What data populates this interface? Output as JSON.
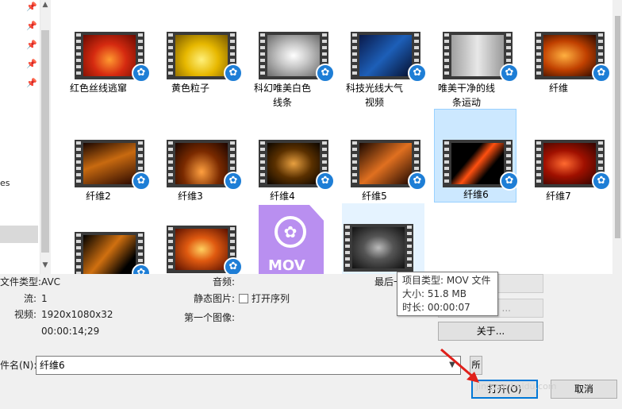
{
  "files": [
    {
      "name": "红色丝线逃窜"
    },
    {
      "name": "黄色粒子"
    },
    {
      "name": "科幻唯美白色线条"
    },
    {
      "name": "科技光线大气视频"
    },
    {
      "name": "唯美干净的线条运动"
    },
    {
      "name": "纤维"
    },
    {
      "name": "纤维2"
    },
    {
      "name": "纤维3"
    },
    {
      "name": "纤维4"
    },
    {
      "name": "纤维5"
    },
    {
      "name": "纤维6"
    },
    {
      "name": "纤维7"
    }
  ],
  "nav": {
    "partial_text": "es"
  },
  "mov_icon": {
    "label": "MOV"
  },
  "details": {
    "file_type_label": "文件类型:",
    "file_type_value": "AVC",
    "stream_label": "流:",
    "stream_value": "1",
    "video_label": "视频:",
    "video_value": "1920x1080x32",
    "duration_value": "00:00:14;29",
    "audio_label": "音频:",
    "still_label": "静态图片:",
    "sequence_label": "打开序列",
    "first_image_label": "第一个图像:",
    "last_label": "最后一"
  },
  "tooltip": {
    "type_line": "项目类型: MOV 文件",
    "size_line": "大小: 51.8 MB",
    "duration_line": "时长: 00:00:07"
  },
  "buttons": {
    "partial_btn": "...",
    "about": "关于...",
    "open": "打开(O)",
    "cancel": "取消",
    "file_type_partial": "所"
  },
  "filename": {
    "label": "件名(N):",
    "value": "纤维6"
  },
  "watermark": "jingyan.baidu.com",
  "colors": {
    "selection": "#cce8ff",
    "accent": "#0078d7",
    "badge": "#1e7ed6",
    "mov": "#b98ff0",
    "arrow": "#e0201a"
  }
}
